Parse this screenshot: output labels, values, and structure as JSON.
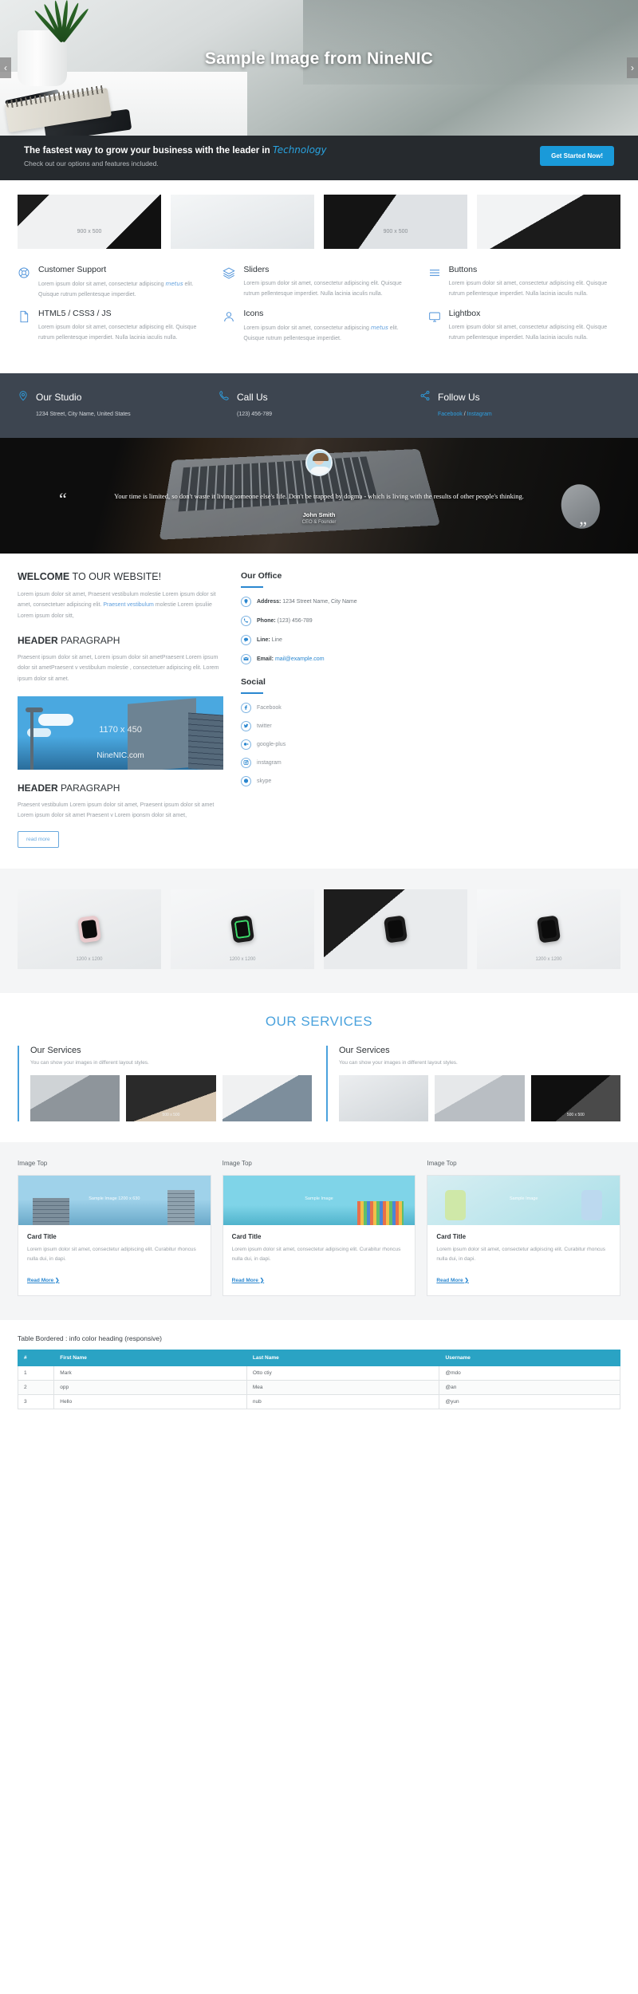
{
  "hero": {
    "title": "Sample Image from NineNIC",
    "prev": "‹",
    "next": "›"
  },
  "cta": {
    "title_main": "The fastest way to grow your business with the leader in",
    "title_accent": "Technology",
    "subtitle": "Check out our options and features included.",
    "button": "Get Started Now!"
  },
  "thumbs": [
    {
      "label": "900 x 500"
    },
    {
      "label": ""
    },
    {
      "label": "900 x 500"
    },
    {
      "label": ""
    }
  ],
  "features": [
    {
      "icon": "lifebuoy-icon",
      "title": "Customer Support",
      "text_a": "Lorem ipsum dolor sit amet, consectetur adipiscing ",
      "text_hl": "metus",
      "text_b": " elit. Quisque rutrum pellentesque imperdiet."
    },
    {
      "icon": "layers-icon",
      "title": "Sliders",
      "text_a": "Lorem ipsum dolor sit amet, consectetur adipiscing elit. Quisque rutrum pellentesque imperdiet. Nulla lacinia iaculis nulla.",
      "text_hl": "",
      "text_b": ""
    },
    {
      "icon": "menu-lines-icon",
      "title": "Buttons",
      "text_a": "Lorem ipsum dolor sit amet, consectetur adipiscing elit. Quisque rutrum pellentesque imperdiet. Nulla lacinia iaculis nulla.",
      "text_hl": "",
      "text_b": ""
    },
    {
      "icon": "file-icon",
      "title": "HTML5 / CSS3 / JS",
      "text_a": "Lorem ipsum dolor sit amet, consectetur adipiscing elit. Quisque rutrum pellentesque imperdiet. Nulla lacinia iaculis nulla.",
      "text_hl": "",
      "text_b": ""
    },
    {
      "icon": "user-icon",
      "title": "Icons",
      "text_a": "Lorem ipsum dolor sit amet, consectetur adipiscing ",
      "text_hl": "metus",
      "text_b": " elit. Quisque rutrum pellentesque imperdiet."
    },
    {
      "icon": "monitor-icon",
      "title": "Lightbox",
      "text_a": "Lorem ipsum dolor sit amet, consectetur adipiscing elit. Quisque rutrum pellentesque imperdiet. Nulla lacinia iaculis nulla.",
      "text_hl": "",
      "text_b": ""
    }
  ],
  "strip": [
    {
      "icon": "map-pin-icon",
      "title": "Our Studio",
      "sub": "1234 Street, City Name, United States",
      "links": []
    },
    {
      "icon": "phone-icon",
      "title": "Call Us",
      "sub": "(123) 456-789",
      "links": []
    },
    {
      "icon": "share-icon",
      "title": "Follow Us",
      "sub": "",
      "links": [
        "Facebook",
        "Instagram"
      ],
      "separator": " / "
    }
  ],
  "testimonial": {
    "quote": "Your time is limited, so don't waste it living someone else's life. Don't be trapped by dogma - which is living with the results of other people's thinking.",
    "name": "John Smith",
    "role": "CEO & Founder",
    "quote_open": "“",
    "quote_close": "”"
  },
  "welcome": {
    "heading_bold": "WELCOME",
    "heading_rest": " TO OUR WEBSITE!",
    "para1_a": "Lorem ipsum dolor sit amet, Praesent vestibulum molestie Lorem ipsum dolor sit amet, consectetuer adipiscing elit. ",
    "para1_link": "Praesent vestibulum",
    "para1_b": " molestie Lorem ipsuliie Lorem ipsum dolor sitt,",
    "heading2_bold": "HEADER",
    "heading2_rest": " PARAGRAPH",
    "para2": "Praesent ipsum dolor sit amet, Lorem ipsum dolor sit ametPraesent Lorem ipsum dolor sit ametPraesent v vestibulum molestie , consectetuer adipiscing elit.  Lorem ipsum dolor sit amet.",
    "image_label_top": "1170 x 450",
    "image_label_bottom": "NineNIC.com",
    "heading3_bold": "HEADER",
    "heading3_rest": " PARAGRAPH",
    "para3": "Praesent vestibulum Lorem ipsum dolor sit amet, Praesent ipsum dolor sit amet Lorem ipsum dolor sit amet Praesent v Lorem iponsm dolor sit amet,",
    "button": "read more"
  },
  "office": {
    "heading": "Our Office",
    "items": [
      {
        "icon": "map-pin-icon",
        "label": "Address:",
        "value": " 1234 Street Name, City Name",
        "is_mail": false
      },
      {
        "icon": "phone-icon",
        "label": "Phone:",
        "value": " (123) 456-789",
        "is_mail": false
      },
      {
        "icon": "chat-icon",
        "label": "Line:",
        "value": " Line",
        "is_mail": false
      },
      {
        "icon": "envelope-icon",
        "label": "Email:",
        "value": " mail@example.com",
        "is_mail": true
      }
    ],
    "social_heading": "Social",
    "social": [
      {
        "icon": "facebook-icon",
        "label": "Facebook"
      },
      {
        "icon": "twitter-icon",
        "label": "twitter"
      },
      {
        "icon": "google-plus-icon",
        "label": "google-plus"
      },
      {
        "icon": "instagram-icon",
        "label": "instagram"
      },
      {
        "icon": "skype-icon",
        "label": "skype"
      }
    ]
  },
  "gallery": [
    {
      "label": "1200 x 1200"
    },
    {
      "label": "1200 x 1200"
    },
    {
      "label": ""
    },
    {
      "label": "1200 x 1200"
    }
  ],
  "services": {
    "heading": "OUR SERVICES",
    "cards": [
      {
        "title": "Our Services",
        "subtitle": "You can show your images in different layout styles.",
        "images": [
          {
            "label": ""
          },
          {
            "label": "500 x 500"
          },
          {
            "label": ""
          }
        ]
      },
      {
        "title": "Our Services",
        "subtitle": "You can show your images in different layout styles.",
        "images": [
          {
            "label": ""
          },
          {
            "label": ""
          },
          {
            "label": "500 x 500"
          }
        ]
      }
    ]
  },
  "cards": [
    {
      "top_label": "Image Top",
      "image_label": "Sample Image  1200 x 630",
      "title": "Card Title",
      "text": "Lorem ipsum dolor sit amet, consectetur adipiscing elit. Curabitur rhoncus nulla dui, in dapi.",
      "link": "Read More",
      "link_arrow": "❯"
    },
    {
      "top_label": "Image Top",
      "image_label": "Sample Image",
      "title": "Card Title",
      "text": "Lorem ipsum dolor sit amet, consectetur adipiscing elit. Curabitur rhoncus nulla dui, in dapi.",
      "link": "Read More",
      "link_arrow": "❯"
    },
    {
      "top_label": "Image Top",
      "image_label": "Sample Image",
      "title": "Card Title",
      "text": "Lorem ipsum dolor sit amet, consectetur adipiscing elit. Curabitur rhoncus nulla dui, in dapi.",
      "link": "Read More",
      "link_arrow": "❯"
    }
  ],
  "table": {
    "title": "Table Bordered : info color heading (responsive)",
    "columns": [
      "#",
      "First Name",
      "Last Name",
      "Username"
    ],
    "rows": [
      [
        "1",
        "Mark",
        "Otto ctiy",
        "@mdo"
      ],
      [
        "2",
        "opp",
        "Mea",
        "@an"
      ],
      [
        "3",
        "Hello",
        "nub",
        "@yun"
      ]
    ]
  },
  "colors": {
    "accent": "#2a87d0",
    "accent_light": "#4aa2dd",
    "dark": "#262a2e",
    "strip": "#3d4550",
    "table_head": "#2aa3c4"
  }
}
